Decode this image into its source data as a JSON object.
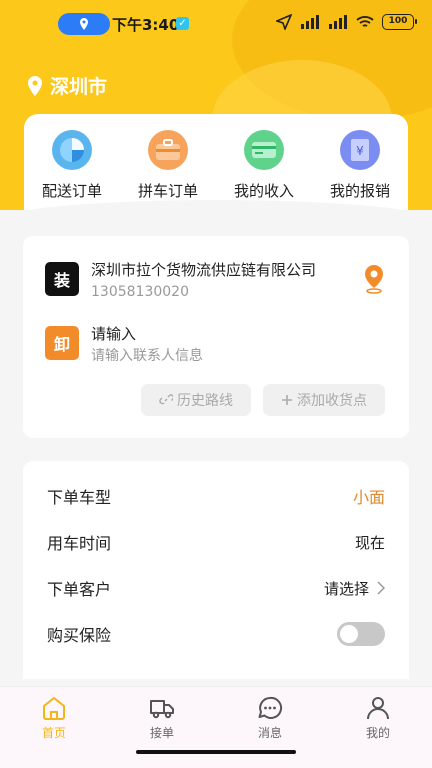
{
  "status_bar": {
    "time": "下午3:40",
    "battery": "100"
  },
  "location": {
    "city": "深圳市"
  },
  "quick_menu": [
    {
      "label": "配送订单",
      "icon": "pie-chart-icon"
    },
    {
      "label": "拼车订单",
      "icon": "briefcase-icon"
    },
    {
      "label": "我的收入",
      "icon": "card-icon"
    },
    {
      "label": "我的报销",
      "icon": "receipt-icon"
    }
  ],
  "route": {
    "load": {
      "badge": "装",
      "title": "深圳市拉个货物流供应链有限公司",
      "phone": "13058130020"
    },
    "unload": {
      "badge": "卸",
      "title": "请输入",
      "subtitle": "请输入联系人信息"
    },
    "history_button": "历史路线",
    "add_stop_button": "添加收货点"
  },
  "options": {
    "vehicle": {
      "label": "下单车型",
      "value": "小面"
    },
    "time": {
      "label": "用车时间",
      "value": "现在"
    },
    "customer": {
      "label": "下单客户",
      "value": "请选择"
    },
    "insurance": {
      "label": "购买保险",
      "enabled": false
    }
  },
  "tabbar": [
    {
      "label": "首页",
      "icon": "home-icon",
      "active": true
    },
    {
      "label": "接单",
      "icon": "truck-icon",
      "active": false
    },
    {
      "label": "消息",
      "icon": "message-icon",
      "active": false
    },
    {
      "label": "我的",
      "icon": "user-icon",
      "active": false
    }
  ],
  "colors": {
    "brand": "#fcc91a",
    "accent": "#e0892a",
    "load_badge": "#111111",
    "unload_badge": "#f28c2b"
  }
}
